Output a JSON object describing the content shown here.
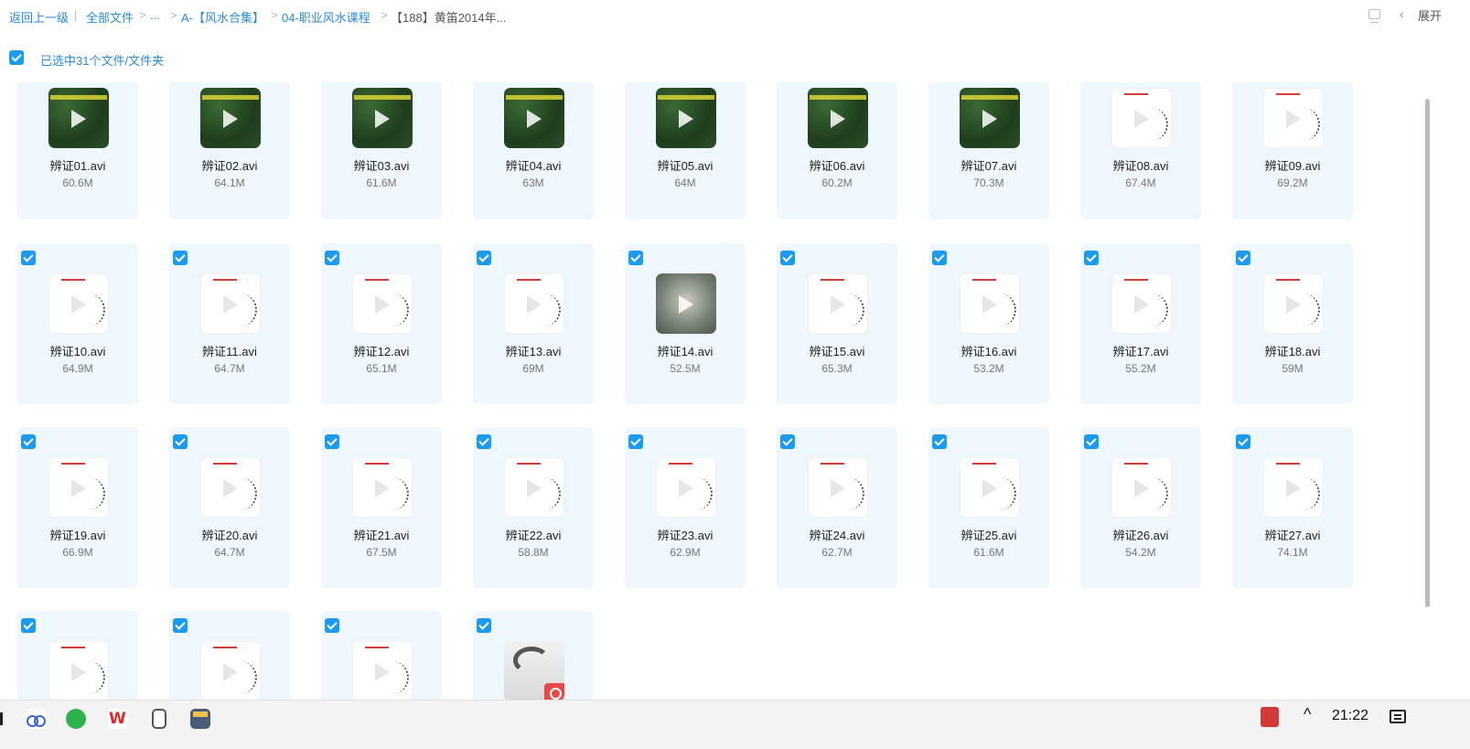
{
  "breadcrumb": {
    "back": "返回上一级",
    "divider": "|",
    "items": [
      "全部文件",
      "...",
      "A-【风水合集】",
      "04-职业风水课程"
    ],
    "separator": ">",
    "current": "【188】黄笛2014年..."
  },
  "header": {
    "expand_label": "展开",
    "expand_icon": "chevron-left-icon",
    "view_icon": "layout-icon"
  },
  "selection": {
    "checked": true,
    "label": "已选中31个文件/文件夹"
  },
  "files": [
    {
      "name": "辨证01.avi",
      "size": "60.6M",
      "thumb": "green"
    },
    {
      "name": "辨证02.avi",
      "size": "64.1M",
      "thumb": "green"
    },
    {
      "name": "辨证03.avi",
      "size": "61.6M",
      "thumb": "green"
    },
    {
      "name": "辨证04.avi",
      "size": "63M",
      "thumb": "green"
    },
    {
      "name": "辨证05.avi",
      "size": "64M",
      "thumb": "green"
    },
    {
      "name": "辨证06.avi",
      "size": "60.2M",
      "thumb": "green"
    },
    {
      "name": "辨证07.avi",
      "size": "70.3M",
      "thumb": "green"
    },
    {
      "name": "辨证08.avi",
      "size": "67.4M",
      "thumb": "white"
    },
    {
      "name": "辨证09.avi",
      "size": "69.2M",
      "thumb": "white"
    },
    {
      "name": "辨证10.avi",
      "size": "64.9M",
      "thumb": "white"
    },
    {
      "name": "辨证11.avi",
      "size": "64.7M",
      "thumb": "white"
    },
    {
      "name": "辨证12.avi",
      "size": "65.1M",
      "thumb": "white"
    },
    {
      "name": "辨证13.avi",
      "size": "69M",
      "thumb": "white"
    },
    {
      "name": "辨证14.avi",
      "size": "52.5M",
      "thumb": "map"
    },
    {
      "name": "辨证15.avi",
      "size": "65.3M",
      "thumb": "white"
    },
    {
      "name": "辨证16.avi",
      "size": "53.2M",
      "thumb": "white"
    },
    {
      "name": "辨证17.avi",
      "size": "55.2M",
      "thumb": "white"
    },
    {
      "name": "辨证18.avi",
      "size": "59M",
      "thumb": "white"
    },
    {
      "name": "辨证19.avi",
      "size": "66.9M",
      "thumb": "white"
    },
    {
      "name": "辨证20.avi",
      "size": "64.7M",
      "thumb": "white"
    },
    {
      "name": "辨证21.avi",
      "size": "67.5M",
      "thumb": "white"
    },
    {
      "name": "辨证22.avi",
      "size": "58.8M",
      "thumb": "white"
    },
    {
      "name": "辨证23.avi",
      "size": "62.9M",
      "thumb": "white"
    },
    {
      "name": "辨证24.avi",
      "size": "62.7M",
      "thumb": "white"
    },
    {
      "name": "辨证25.avi",
      "size": "61.6M",
      "thumb": "white"
    },
    {
      "name": "辨证26.avi",
      "size": "54.2M",
      "thumb": "white"
    },
    {
      "name": "辨证27.avi",
      "size": "74.1M",
      "thumb": "white"
    },
    {
      "name": "",
      "size": "",
      "thumb": "white"
    },
    {
      "name": "",
      "size": "",
      "thumb": "white"
    },
    {
      "name": "",
      "size": "",
      "thumb": "white"
    },
    {
      "name": "",
      "size": "",
      "thumb": "pdf"
    }
  ],
  "taskbar": {
    "apps": [
      "baidu-netdisk-icon",
      "wechat-icon",
      "wps-icon",
      "notepad-icon",
      "calculator-icon"
    ],
    "wps_glyph": "W",
    "tray_up_glyph": "^",
    "clock": "21:22"
  },
  "colors": {
    "accent": "#1a9bf0",
    "link": "#2a8bd8",
    "card_bg": "#eef7fd"
  }
}
